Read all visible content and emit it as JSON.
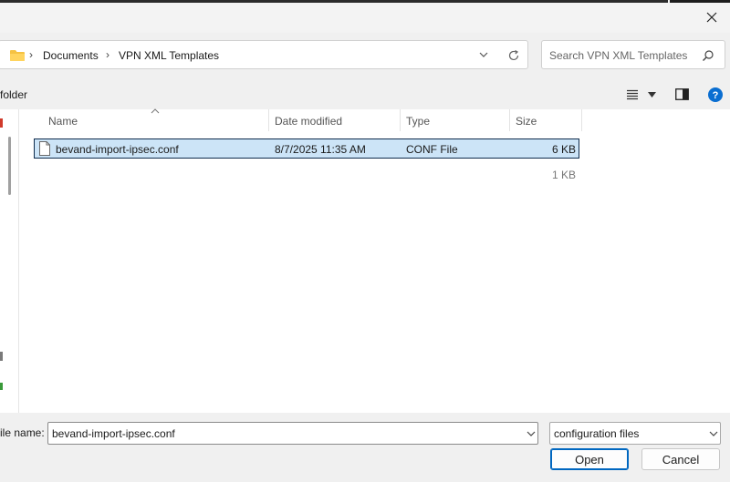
{
  "breadcrumb": {
    "items": [
      "Documents",
      "VPN XML Templates"
    ]
  },
  "search": {
    "placeholder": "Search VPN XML Templates"
  },
  "toolbar": {
    "new_folder_label": "folder"
  },
  "columns": {
    "name": "Name",
    "date": "Date modified",
    "type": "Type",
    "size": "Size"
  },
  "files": [
    {
      "name": "bevand-import-ipsec.conf",
      "date": "8/7/2025 11:35 AM",
      "type": "CONF File",
      "size": "6 KB",
      "selected": true
    },
    {
      "name": "",
      "date": "",
      "type": "",
      "size": "1 KB",
      "selected": false
    }
  ],
  "footer": {
    "file_name_label": "ile name:",
    "file_name_value": "bevand-import-ipsec.conf",
    "file_type": "configuration files",
    "open_label": "Open",
    "cancel_label": "Cancel"
  },
  "icons": {
    "folder": "folder-icon",
    "chevron": "chevron-right-icon",
    "refresh": "refresh-icon",
    "search": "search-icon",
    "view": "view-menu-icon",
    "preview": "preview-pane-icon",
    "help": "help-icon",
    "file": "file-icon",
    "close": "close-icon"
  },
  "colors": {
    "accent": "#0067c0",
    "selection": "#cce4f7",
    "help": "#0a6ed1"
  }
}
